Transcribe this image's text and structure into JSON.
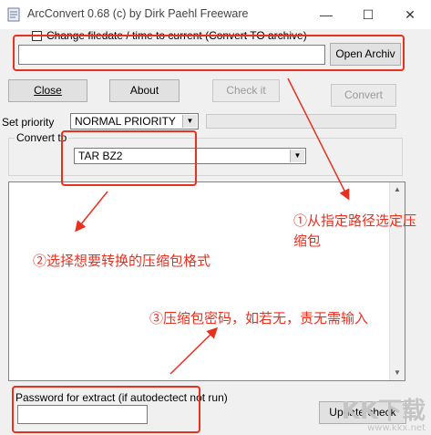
{
  "window": {
    "title": "ArcConvert 0.68 (c) by Dirk Paehl Freeware",
    "min_glyph": "—",
    "max_glyph": "☐",
    "close_glyph": "✕"
  },
  "top": {
    "change_filedate_label": "Change filedate / time to current (Convert TO archive)",
    "path_value": "",
    "open_archive_label": "Open Archiv"
  },
  "buttons": {
    "close_label": "Close",
    "about_label": "About",
    "checkit_label": "Check it",
    "convert_label": "Convert",
    "update_check_label": "Update check"
  },
  "priority": {
    "label": "Set priority",
    "value": "NORMAL PRIORITY"
  },
  "convert_to": {
    "label": "Convert to",
    "value": "TAR BZ2"
  },
  "password": {
    "label": "Password for extract (if autodectect not run)",
    "value": ""
  },
  "annotations": {
    "step1": "①从指定路径选定压",
    "step1_line2": "缩包",
    "step2": "②选择想要转换的压缩包格式",
    "step3": "③压缩包密码，如若无，责无需输入"
  },
  "watermark": {
    "logo": "KK下载",
    "url": "www.kkx.net"
  },
  "colors": {
    "annotation_red": "#e8301f",
    "window_bg": "#f0f0f0"
  }
}
